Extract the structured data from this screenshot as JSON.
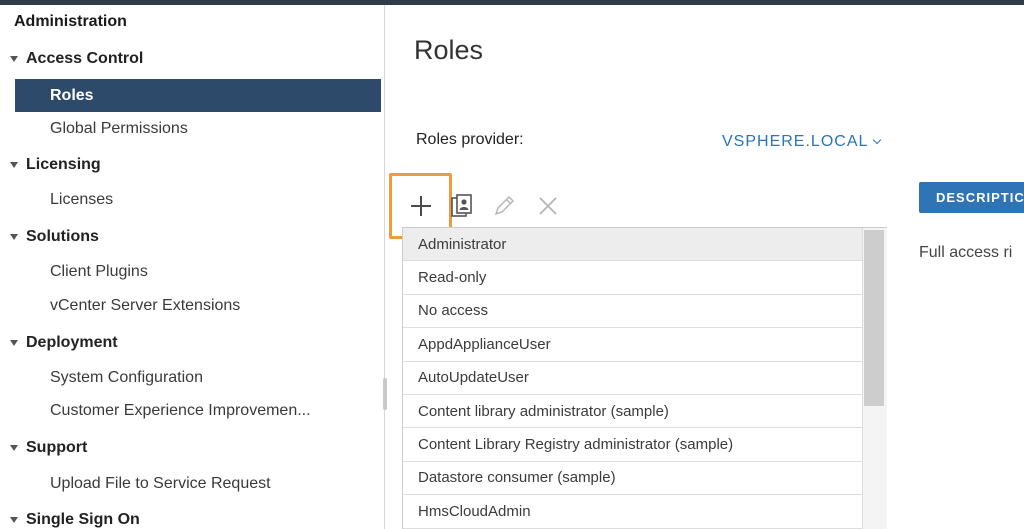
{
  "sidebar": {
    "title": "Administration",
    "groups": [
      {
        "label": "Access Control",
        "items": [
          "Roles",
          "Global Permissions"
        ]
      },
      {
        "label": "Licensing",
        "items": [
          "Licenses"
        ]
      },
      {
        "label": "Solutions",
        "items": [
          "Client Plugins",
          "vCenter Server Extensions"
        ]
      },
      {
        "label": "Deployment",
        "items": [
          "System Configuration",
          "Customer Experience Improvemen..."
        ]
      },
      {
        "label": "Support",
        "items": [
          "Upload File to Service Request"
        ]
      },
      {
        "label": "Single Sign On",
        "items": []
      }
    ],
    "selected_item": "Roles"
  },
  "main": {
    "title": "Roles",
    "provider_label": "Roles provider:",
    "provider_value": "VSPHERE.LOCAL",
    "toolbar": {
      "icons": [
        "plus-icon",
        "clone-icon",
        "pencil-icon",
        "close-icon"
      ]
    },
    "roles": [
      "Administrator",
      "Read-only",
      "No access",
      "AppdApplianceUser",
      "AutoUpdateUser",
      "Content library administrator (sample)",
      "Content Library Registry administrator (sample)",
      "Datastore consumer (sample)",
      "HmsCloudAdmin"
    ],
    "selected_role": "Administrator",
    "detail_tab": "DESCRIPTIC",
    "detail_text": "Full access ri"
  },
  "colors": {
    "accent": "#2f74b5",
    "selected_nav": "#2d4a6b",
    "highlight_border": "#f09a3e",
    "link": "#2a74b8"
  }
}
